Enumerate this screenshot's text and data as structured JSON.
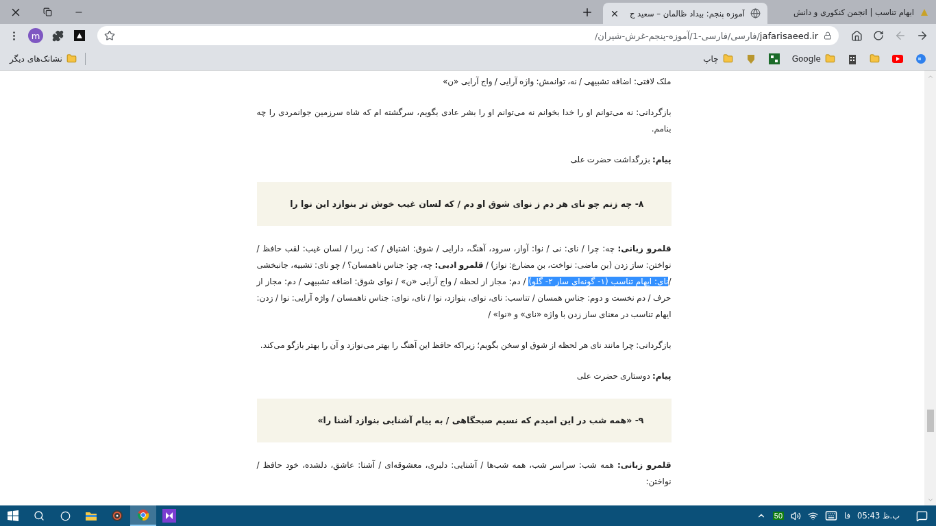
{
  "tabs": [
    {
      "title": "ابهام تناسب | انجمن کنکوری و دانش",
      "selected": false
    },
    {
      "title": "آموزه پنجم: بیداد ظالمان – سعید ج",
      "selected": true
    }
  ],
  "address": {
    "domain": "jafarisaeed.ir",
    "path": "/فارسی/فارسی-1/آموزه-پنجم-غرش-شیران/"
  },
  "profile_initial": "m",
  "bookmarks": [
    {
      "label": "Google"
    },
    {
      "label": "چاپ"
    }
  ],
  "other_bookmarks": "نشانک‌های دیگر",
  "content": [
    {
      "kind": "text",
      "text": "ملک لافتی: اضافه تشبیهی / نه، توانمش: واژه آرایی / واج آرایی «ن»"
    },
    {
      "kind": "text",
      "text": "بازگردانی: نه می‌توانم او را خدا بخوانم نه می‌توانم او را بشر عادی بگویم، سرگشته ام که شاه سرزمین جوانمردی را چه بنامم."
    },
    {
      "kind": "text",
      "text": "**پیام:** بزرگداشت حضرت علی"
    },
    {
      "kind": "verse",
      "text": "۸- چه زنم چو نای هر دم ز نوای شوق او دم / که لسان غیب خوش تر بنوازد این نوا را"
    },
    {
      "kind": "text",
      "segments": [
        {
          "text": "**قلمرو زبانی:** چه: چرا / نای: نی / نوا: آواز، سرود، آهنگ، دارایی / شوق: اشتیاق / که: زیرا / لسان غیب: لقب حافظ / نواختن: ساز زدن (بن ماضی: نواخت، بن مضارع: نواز) / **قلمرو ادبی:** چه، چو: جناس ناهمسان؟ / چو نای: تشبیه، جانبخشی /",
          "selected": false
        },
        {
          "text": "نای: ایهام تناسب (۱- گونه‌ای ساز ۲- گلو)",
          "selected": true
        },
        {
          "text": " / دم: مجاز از لحظه / واج آرایی «ن» / نوای شوق: اضافه تشبیهی / دم: مجاز از حرف / دم نخست و دوم: جناس همسان / تناسب: نای، نوای، بنوازد، نوا / نای، نوای: جناس ناهمسان / واژه آرایی: نوا / زدن: ایهام تناسب در معنای ساز زدن با واژه «نای» و «نوا» /",
          "selected": false
        }
      ]
    },
    {
      "kind": "text",
      "text": "بازگردانی: چرا مانند نای هر لحظه از شوق او سخن بگویم؛ زیراکه حافظ این آهنگ را بهتر می‌نوازد و آن را بهتر بازگو می‌کند."
    },
    {
      "kind": "text",
      "text": "**پیام:** دوستاری حضرت علی"
    },
    {
      "kind": "verse",
      "text": "۹- «همه شب در این امیدم که نسیم صبحگاهی / به پیام آشنایی بنوازد آشنا را»"
    },
    {
      "kind": "text",
      "text": "**قلمرو زبانی:** همه شب: سراسر شب، همه شب‌ها / آشنایی: دلبری، معشوقه‌ای / آشنا: عاشق، دلشده، خود حافظ / نواختن:"
    }
  ],
  "taskbar": {
    "apps": [
      {
        "kind": "explorer",
        "selected": false
      },
      {
        "kind": "media",
        "selected": false
      },
      {
        "kind": "chrome",
        "selected": true
      },
      {
        "kind": "studio",
        "selected": false
      }
    ],
    "battery": "50",
    "language": "فا",
    "time": "05:43 ب.ظ"
  }
}
